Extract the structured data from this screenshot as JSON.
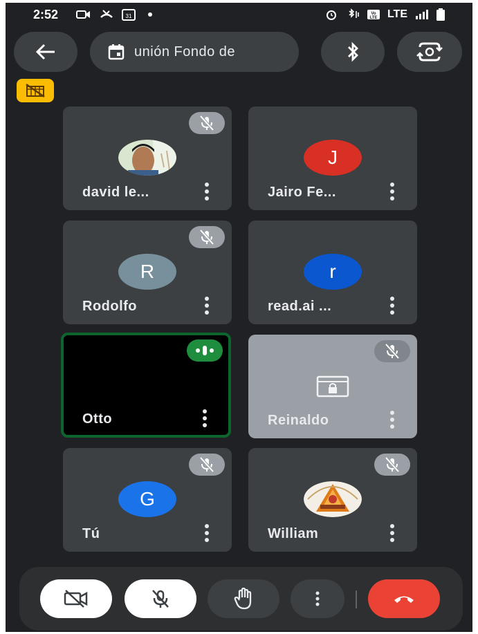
{
  "status_bar": {
    "time": "2:52",
    "network": "LTE",
    "icons_left": [
      "video-notification-icon",
      "missed-call-icon",
      "calendar-31-icon",
      "notification-dot"
    ],
    "icons_right": [
      "alarm-icon",
      "bluetooth-vibrate-icon",
      "volte-icon",
      "signal-icon",
      "battery-icon"
    ]
  },
  "top_bar": {
    "meeting_title": "unión Fondo de",
    "back_icon": "arrow-back-icon",
    "calendar_icon": "calendar-icon",
    "bluetooth_icon": "bluetooth-icon",
    "switch_camera_icon": "switch-camera-icon"
  },
  "badge": {
    "icon": "no-camera-warning-icon",
    "color": "#fbbc04"
  },
  "participants": [
    {
      "name": "david le...",
      "avatar": "photo",
      "muted": true
    },
    {
      "name": "Jairo Fe...",
      "avatar": "J",
      "avatar_color": "#d93025",
      "muted": false
    },
    {
      "name": "Rodolfo",
      "avatar": "R",
      "avatar_color": "#78909c",
      "muted": true
    },
    {
      "name": "read.ai ...",
      "avatar": "r",
      "avatar_color": "#0b57d0",
      "muted": false
    },
    {
      "name": "Otto",
      "avatar": "",
      "speaking": true
    },
    {
      "name": "Reinaldo",
      "avatar": "locked-screen-icon",
      "muted": true
    },
    {
      "name": "Tú",
      "avatar": "G",
      "avatar_color": "#1a73e8",
      "muted": true
    },
    {
      "name": "William",
      "avatar": "logo",
      "muted": true
    }
  ],
  "controls": {
    "camera": "camera-off-icon",
    "mic": "mic-off-icon",
    "hand": "raise-hand-icon",
    "more": "more-vert-icon",
    "hangup": "end-call-icon",
    "hangup_color": "#ea4335"
  }
}
